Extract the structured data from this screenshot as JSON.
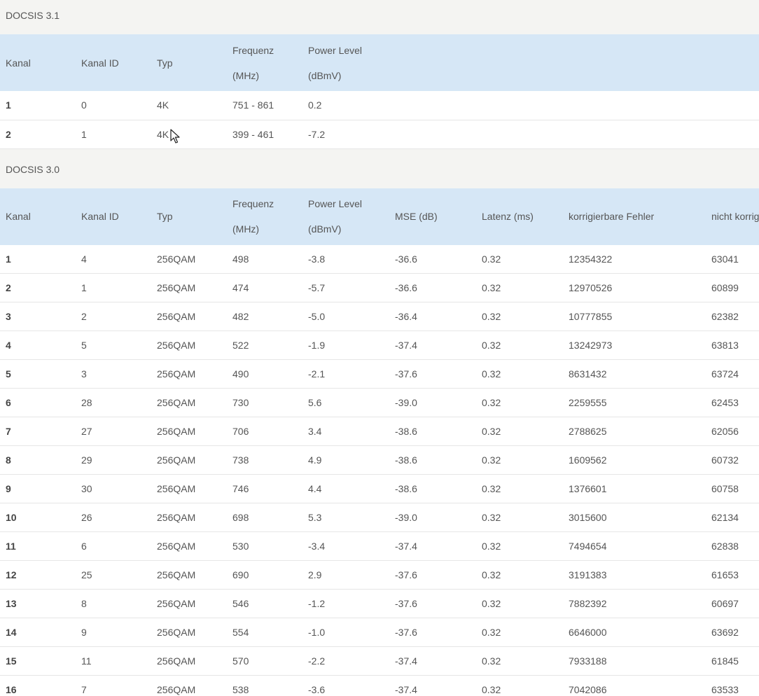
{
  "docsis31": {
    "title": "DOCSIS 3.1",
    "headers": {
      "kanal": "Kanal",
      "kanal_id": "Kanal ID",
      "typ": "Typ",
      "freq_line1": "Frequenz",
      "freq_line2": "(MHz)",
      "power_line1": "Power Level",
      "power_line2": "(dBmV)"
    },
    "rows": [
      {
        "kanal": "1",
        "kanal_id": "0",
        "typ": "4K",
        "freq": "751 - 861",
        "power": "0.2"
      },
      {
        "kanal": "2",
        "kanal_id": "1",
        "typ": "4K",
        "freq": "399 - 461",
        "power": "-7.2"
      }
    ]
  },
  "docsis30": {
    "title": "DOCSIS 3.0",
    "headers": {
      "kanal": "Kanal",
      "kanal_id": "Kanal ID",
      "typ": "Typ",
      "freq_line1": "Frequenz",
      "freq_line2": "(MHz)",
      "power_line1": "Power Level",
      "power_line2": "(dBmV)",
      "mse": "MSE (dB)",
      "latenz": "Latenz (ms)",
      "korr": "korrigierbare Fehler",
      "nicht_korr": "nicht korrigierbare Fehler"
    },
    "rows": [
      {
        "kanal": "1",
        "kanal_id": "4",
        "typ": "256QAM",
        "freq": "498",
        "power": "-3.8",
        "mse": "-36.6",
        "latenz": "0.32",
        "korr": "12354322",
        "nicht_korr": "63041"
      },
      {
        "kanal": "2",
        "kanal_id": "1",
        "typ": "256QAM",
        "freq": "474",
        "power": "-5.7",
        "mse": "-36.6",
        "latenz": "0.32",
        "korr": "12970526",
        "nicht_korr": "60899"
      },
      {
        "kanal": "3",
        "kanal_id": "2",
        "typ": "256QAM",
        "freq": "482",
        "power": "-5.0",
        "mse": "-36.4",
        "latenz": "0.32",
        "korr": "10777855",
        "nicht_korr": "62382"
      },
      {
        "kanal": "4",
        "kanal_id": "5",
        "typ": "256QAM",
        "freq": "522",
        "power": "-1.9",
        "mse": "-37.4",
        "latenz": "0.32",
        "korr": "13242973",
        "nicht_korr": "63813"
      },
      {
        "kanal": "5",
        "kanal_id": "3",
        "typ": "256QAM",
        "freq": "490",
        "power": "-2.1",
        "mse": "-37.6",
        "latenz": "0.32",
        "korr": "8631432",
        "nicht_korr": "63724"
      },
      {
        "kanal": "6",
        "kanal_id": "28",
        "typ": "256QAM",
        "freq": "730",
        "power": "5.6",
        "mse": "-39.0",
        "latenz": "0.32",
        "korr": "2259555",
        "nicht_korr": "62453"
      },
      {
        "kanal": "7",
        "kanal_id": "27",
        "typ": "256QAM",
        "freq": "706",
        "power": "3.4",
        "mse": "-38.6",
        "latenz": "0.32",
        "korr": "2788625",
        "nicht_korr": "62056"
      },
      {
        "kanal": "8",
        "kanal_id": "29",
        "typ": "256QAM",
        "freq": "738",
        "power": "4.9",
        "mse": "-38.6",
        "latenz": "0.32",
        "korr": "1609562",
        "nicht_korr": "60732"
      },
      {
        "kanal": "9",
        "kanal_id": "30",
        "typ": "256QAM",
        "freq": "746",
        "power": "4.4",
        "mse": "-38.6",
        "latenz": "0.32",
        "korr": "1376601",
        "nicht_korr": "60758"
      },
      {
        "kanal": "10",
        "kanal_id": "26",
        "typ": "256QAM",
        "freq": "698",
        "power": "5.3",
        "mse": "-39.0",
        "latenz": "0.32",
        "korr": "3015600",
        "nicht_korr": "62134"
      },
      {
        "kanal": "11",
        "kanal_id": "6",
        "typ": "256QAM",
        "freq": "530",
        "power": "-3.4",
        "mse": "-37.4",
        "latenz": "0.32",
        "korr": "7494654",
        "nicht_korr": "62838"
      },
      {
        "kanal": "12",
        "kanal_id": "25",
        "typ": "256QAM",
        "freq": "690",
        "power": "2.9",
        "mse": "-37.6",
        "latenz": "0.32",
        "korr": "3191383",
        "nicht_korr": "61653"
      },
      {
        "kanal": "13",
        "kanal_id": "8",
        "typ": "256QAM",
        "freq": "546",
        "power": "-1.2",
        "mse": "-37.6",
        "latenz": "0.32",
        "korr": "7882392",
        "nicht_korr": "60697"
      },
      {
        "kanal": "14",
        "kanal_id": "9",
        "typ": "256QAM",
        "freq": "554",
        "power": "-1.0",
        "mse": "-37.6",
        "latenz": "0.32",
        "korr": "6646000",
        "nicht_korr": "63692"
      },
      {
        "kanal": "15",
        "kanal_id": "11",
        "typ": "256QAM",
        "freq": "570",
        "power": "-2.2",
        "mse": "-37.4",
        "latenz": "0.32",
        "korr": "7933188",
        "nicht_korr": "61845"
      },
      {
        "kanal": "16",
        "kanal_id": "7",
        "typ": "256QAM",
        "freq": "538",
        "power": "-3.6",
        "mse": "-37.4",
        "latenz": "0.32",
        "korr": "7042086",
        "nicht_korr": "63533"
      }
    ]
  },
  "colors": {
    "section_bg": "#f4f4f2",
    "header_bg": "#d6e7f6",
    "row_border": "#e6e6e6",
    "text": "#555555"
  },
  "cursor": {
    "icon": "mouse-pointer-icon"
  }
}
